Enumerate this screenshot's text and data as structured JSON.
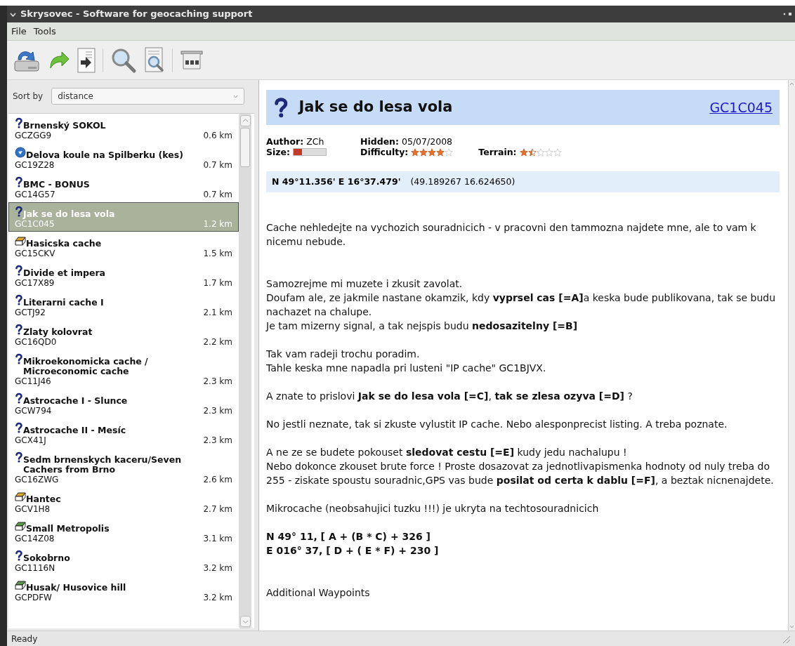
{
  "window": {
    "title": "Skrysovec - Software for geocaching support"
  },
  "menu": [
    "File",
    "Tools"
  ],
  "sort": {
    "label": "Sort by",
    "value": "distance"
  },
  "caches": [
    {
      "kind": "question",
      "name": "Brnenský SOKOL",
      "code": "GCZGG9",
      "distance": "0.6 km",
      "selected": false
    },
    {
      "kind": "disc",
      "name": "Delova koule na Spilberku (kes)",
      "code": "GC19Z28",
      "distance": "0.7 km",
      "selected": false
    },
    {
      "kind": "question",
      "name": "BMC - BONUS",
      "code": "GC14G57",
      "distance": "0.7 km",
      "selected": false
    },
    {
      "kind": "question",
      "name": "Jak se do lesa vola",
      "code": "GC1C045",
      "distance": "1.2 km",
      "selected": true
    },
    {
      "kind": "yellowbox",
      "name": "Hasicska cache",
      "code": "GC15CKV",
      "distance": "1.5 km",
      "selected": false
    },
    {
      "kind": "question",
      "name": "Divide et impera",
      "code": "GC17X89",
      "distance": "1.7 km",
      "selected": false
    },
    {
      "kind": "question",
      "name": "Literarni cache I",
      "code": "GCTJ92",
      "distance": "2.1 km",
      "selected": false
    },
    {
      "kind": "question",
      "name": "Zlaty kolovrat",
      "code": "GC16QD0",
      "distance": "2.2 km",
      "selected": false
    },
    {
      "kind": "question",
      "name": "Mikroekonomicka cache / Microeconomic cache",
      "code": "GC11J46",
      "distance": "2.3 km",
      "selected": false
    },
    {
      "kind": "question",
      "name": "Astrocache I - Slunce",
      "code": "GCW794",
      "distance": "2.3 km",
      "selected": false
    },
    {
      "kind": "question",
      "name": "Astrocache II - Mesíc",
      "code": "GCX41J",
      "distance": "2.3 km",
      "selected": false
    },
    {
      "kind": "question",
      "name": "Sedm brnenskych kaceru/Seven Cachers from Brno",
      "code": "GC16ZWG",
      "distance": "2.6 km",
      "selected": false
    },
    {
      "kind": "yellowbox",
      "name": "Hantec",
      "code": "GCV1H8",
      "distance": "2.7 km",
      "selected": false
    },
    {
      "kind": "greenbox",
      "name": "Small Metropolis",
      "code": "GC14Z08",
      "distance": "3.1 km",
      "selected": false
    },
    {
      "kind": "question",
      "name": "Sokobrno",
      "code": "GC1116N",
      "distance": "3.2 km",
      "selected": false
    },
    {
      "kind": "greenbox",
      "name": "Husak/ Husovice hill",
      "code": "GCPDFW",
      "distance": "3.2 km",
      "selected": false
    }
  ],
  "detail": {
    "kind": "question",
    "title": "Jak se do lesa vola",
    "code": "GC1C045",
    "author": {
      "label": "Author:",
      "value": "ZCh"
    },
    "hidden": {
      "label": "Hidden:",
      "value": "05/07/2008"
    },
    "size": {
      "label": "Size:",
      "level": 0.25
    },
    "difficulty": {
      "label": "Difficulty:",
      "stars": 4
    },
    "terrain": {
      "label": "Terrain:",
      "stars": 1.5
    },
    "coords": {
      "text": "N 49°11.356' E 16°37.479'",
      "decimal": "(49.189267 16.624650)"
    },
    "description": [
      [
        "Cache nehledejte na vychozich souradnicich - v pracovni den tammozna najdete mne, ale to vam k nicemu nebude."
      ],
      [
        "Samozrejme mi muzete i zkusit zavolat.",
        "Doufam ale, ze jakmile nastane okamzik, kdy **vyprsel cas [=A]**a keska bude publikovana, tak se budu nachazet na chalupe.",
        "Je tam mizerny signal, a tak nejspis budu **nedosazitelny [=B]**"
      ],
      [
        "Tak vam radeji trochu poradim.",
        "Tahle keska mne napadla pri lusteni \"IP cache\" GC1BJVX."
      ],
      [
        "A znate to prislovi **Jak se do lesa vola [=C]**, **tak se zlesa ozyva [=D]** ?"
      ],
      [
        "No jestli neznate, tak si zkuste vylustit IP cache. Nebo alesponprecist listing. A treba poznate."
      ],
      [
        "A ne ze se budete pokouset **sledovat cestu [=E]** kudy jedu nachalupu !",
        "Nebo dokonce zkouset brute force ! Proste dosazovat za jednotlivapismenka hodnoty od nuly treba do 255 - ziskate spoustu souradnic,GPS vas bude **posilat od certa k dablu [=F]**, a beztak nicnenajdete."
      ],
      [
        "Mikrocache (neobsahujici tuzku !!!) je ukryta na techtosouradnicich"
      ],
      [
        "**N 49° 11, [ A + (B * C) + 326 ]**",
        "**E 016° 37, [ D + ( E * F) + 230 ]**"
      ],
      [
        "Additional Waypoints"
      ]
    ]
  },
  "status_bar": "Ready"
}
